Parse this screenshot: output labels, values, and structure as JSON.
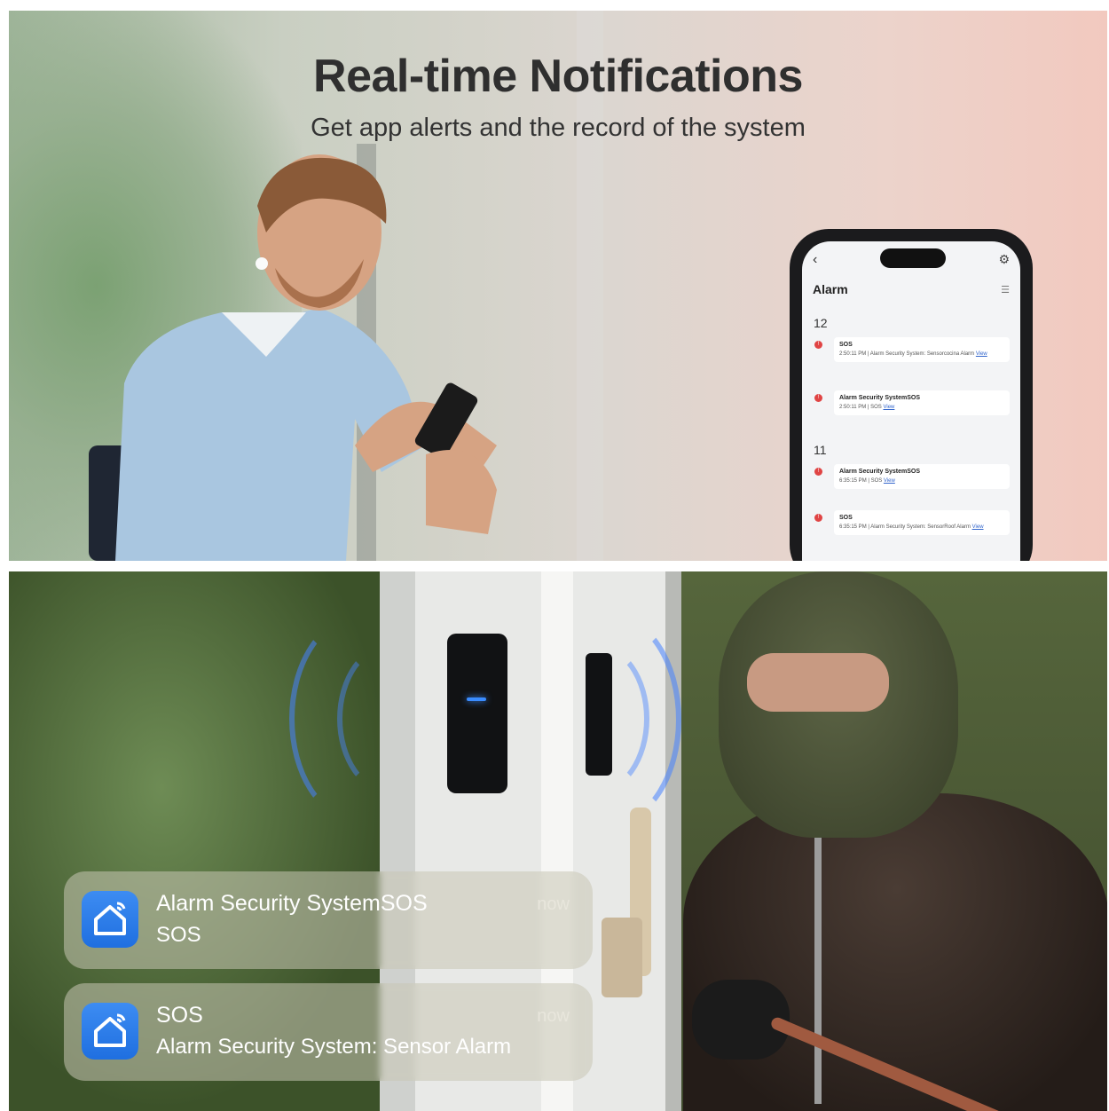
{
  "top": {
    "headline": "Real-time Notifications",
    "subline": "Get app alerts and the record of the system"
  },
  "phone": {
    "back_icon": "chevron-left-icon",
    "settings_icon": "gear-icon",
    "title": "Alarm",
    "groups": [
      {
        "date": "12",
        "entries": [
          {
            "title": "SOS",
            "detail": "2:50:11 PM | Alarm Security System: Sensorcocina Alarm",
            "link": "View"
          },
          {
            "title": "Alarm Security SystemSOS",
            "detail": "2:50:11 PM | SOS",
            "link": "View"
          }
        ]
      },
      {
        "date": "11",
        "entries": [
          {
            "title": "Alarm Security SystemSOS",
            "detail": "6:35:15 PM | SOS",
            "link": "View"
          },
          {
            "title": "SOS",
            "detail": "6:35:15 PM | Alarm Security System: SensorRoof Alarm",
            "link": "View"
          }
        ]
      }
    ]
  },
  "notifications": [
    {
      "icon": "smart-home-app-icon",
      "title": "Alarm Security SystemSOS",
      "body": "SOS",
      "time": "now"
    },
    {
      "icon": "smart-home-app-icon",
      "title": "SOS",
      "body": "Alarm Security System:  Sensor Alarm",
      "time": "now"
    }
  ],
  "colors": {
    "app_icon_blue": "#2a7de9",
    "alarm_dot": "#e04444",
    "sensor_led": "#3a8cff"
  }
}
